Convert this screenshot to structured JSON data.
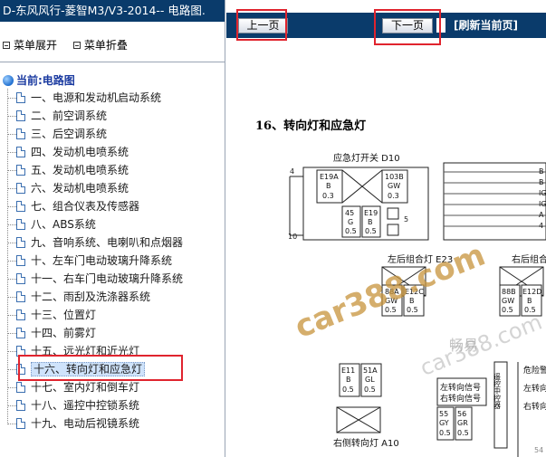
{
  "window": {
    "title": "D-东风风行-菱智M3/V3-2014-- 电路图."
  },
  "menu": {
    "expand_label": "菜单展开",
    "collapse_label": "菜单折叠"
  },
  "tree": {
    "root_label": "当前:电路图",
    "selected_index": 15,
    "items": [
      "一、电源和发动机启动系统",
      "二、前空调系统",
      "三、后空调系统",
      "四、发动机电喷系统",
      "五、发动机电喷系统",
      "六、发动机电喷系统",
      "七、组合仪表及传感器",
      "八、ABS系统",
      "九、音响系统、电喇叭和点烟器",
      "十、左车门电动玻璃升降系统",
      "十一、右车门电动玻璃升降系统",
      "十二、雨刮及洗涤器系统",
      "十三、位置灯",
      "十四、前雾灯",
      "十五、远光灯和近光灯",
      "十六、转向灯和应急灯",
      "十七、室内灯和倒车灯",
      "十八、遥控中控锁系统",
      "十九、电动后视镜系统"
    ]
  },
  "toolbar": {
    "prev_label": "上一页",
    "next_label": "下一页",
    "refresh_label": "[刷新当前页]"
  },
  "document": {
    "title": "16、转向灯和应急灯",
    "labels": {
      "hazard_switch": "应急灯开关 D10",
      "left_combo": "左后组合灯 E23",
      "right_combo": "右后组合灯",
      "right_turn": "右侧转向灯 A10",
      "hazard_right": "危险警",
      "left_signal": "左转向信号",
      "right_signal": "右转向信号",
      "left_turn_r": "左转向",
      "right_turn_r": "右转向",
      "central": "遥控中控器",
      "pin4": "4",
      "pin10": "10",
      "pin5": "5",
      "page_no": "54"
    },
    "wires": {
      "w1": "E19A",
      "w1b": "B",
      "w1c": "0.3",
      "w2": "103B",
      "w2b": "GW",
      "w2c": "0.3",
      "w3": "45",
      "w3b": "G",
      "w3c": "0.5",
      "w4": "E19",
      "w4b": "B",
      "w4c": "0.5",
      "w5": "88A",
      "w5b": "GW",
      "w5c": "0.5",
      "w6": "E12C",
      "w6b": "B",
      "w6c": "0.5",
      "w7": "88B",
      "w7b": "GW",
      "w7c": "0.5",
      "w8": "E12D",
      "w8b": "B",
      "w8c": "0.5",
      "w9": "E11",
      "w9b": "B",
      "w9c": "0.5",
      "w10": "51A",
      "w10b": "GL",
      "w10c": "0.5",
      "w11": "55",
      "w11b": "GY",
      "w11c": "0.5",
      "w12": "56",
      "w12b": "GR",
      "w12c": "0.5"
    },
    "right_edge": [
      "B",
      "B",
      "IG",
      "IG",
      "A",
      "4"
    ],
    "watermarks": {
      "main": "car388.com",
      "secondary": "car388.com",
      "tag": "畅易"
    }
  },
  "colors": {
    "titlebar": "#0a3b6b",
    "highlight_box": "#e0242e",
    "watermark": "#c7943b"
  }
}
